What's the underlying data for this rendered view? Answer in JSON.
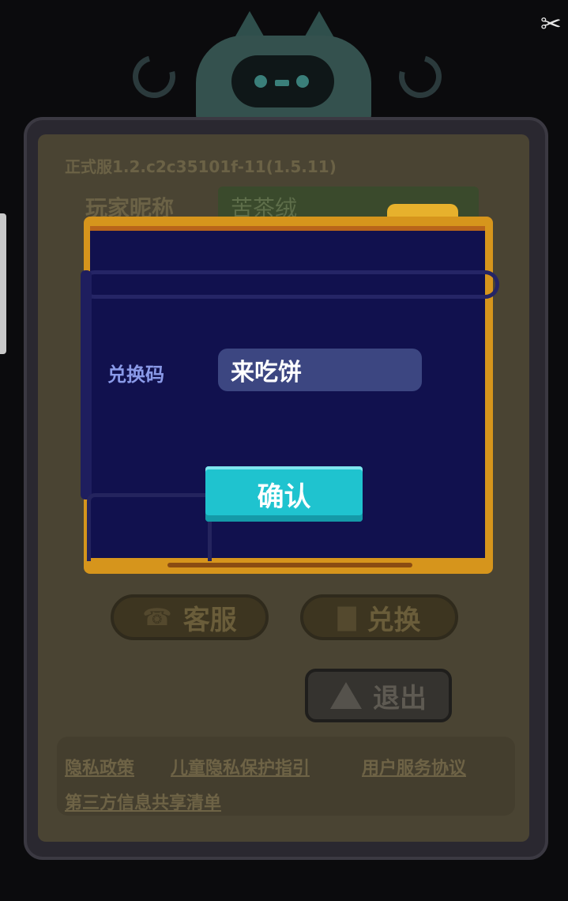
{
  "settings_panel": {
    "version": "正式服1.2.c2c35101f-11(1.5.11)",
    "nickname_label": "玩家昵称",
    "nickname_value": "苦茶绒",
    "support_label": "客服",
    "redeem_label": "兑换",
    "exit_label": "退出",
    "links": [
      "隐私政策",
      "儿童隐私保护指引",
      "用户服务协议",
      "第三方信息共享清单"
    ]
  },
  "redeem_dialog": {
    "code_label": "兑换码",
    "code_value": "来吃饼",
    "confirm_label": "确认"
  },
  "icons": {
    "scissors": "scissors-icon",
    "support": "headset-icon",
    "redeem": "gift-icon",
    "exit": "warning-icon"
  },
  "colors": {
    "dialog_bg": "#11114e",
    "dialog_border": "#d6951c",
    "confirm_button": "#1fc3cf",
    "input_bg": "#3c4681"
  }
}
